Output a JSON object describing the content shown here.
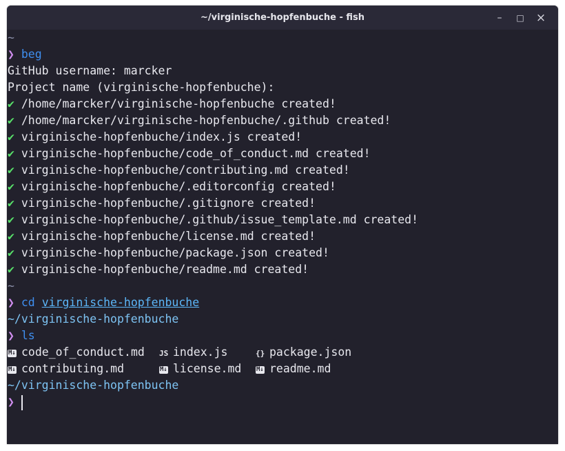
{
  "window": {
    "title": "~/virginische-hopfenbuche - fish",
    "minimize": "–",
    "maximize": "□",
    "close": "×"
  },
  "term": {
    "tilde1": "~",
    "prompt": "❯",
    "cmd1": "beg",
    "out_username": "GitHub username: marcker",
    "out_project": "Project name (virginische-hopfenbuche):",
    "check": "✔",
    "created": [
      "/home/marcker/virginische-hopfenbuche created!",
      "/home/marcker/virginische-hopfenbuche/.github created!",
      "virginische-hopfenbuche/index.js created!",
      "virginische-hopfenbuche/code_of_conduct.md created!",
      "virginische-hopfenbuche/contributing.md created!",
      "virginische-hopfenbuche/.editorconfig created!",
      "virginische-hopfenbuche/.gitignore created!",
      "virginische-hopfenbuche/.github/issue_template.md created!",
      "virginische-hopfenbuche/license.md created!",
      "virginische-hopfenbuche/package.json created!",
      "virginische-hopfenbuche/readme.md created!"
    ],
    "tilde2": "~",
    "cmd2": "cd",
    "cmd2_arg": "virginische-hopfenbuche",
    "cwd1": "~/virginische-hopfenbuche",
    "cmd3": "ls",
    "ls": {
      "r1c1": "code_of_conduct.md",
      "r1c2": "index.js",
      "r1c3": "package.json",
      "r2c1": "contributing.md",
      "r2c2": "license.md",
      "r2c3": "readme.md",
      "icon_md": "M↓",
      "icon_js": "JS",
      "icon_json": "{}"
    },
    "cwd2": "~/virginische-hopfenbuche"
  },
  "colors": {
    "background": "#22212c",
    "prompt": "#d08ef0",
    "command": "#3f8ff0",
    "path": "#7ec4f4",
    "check": "#58e06a"
  }
}
